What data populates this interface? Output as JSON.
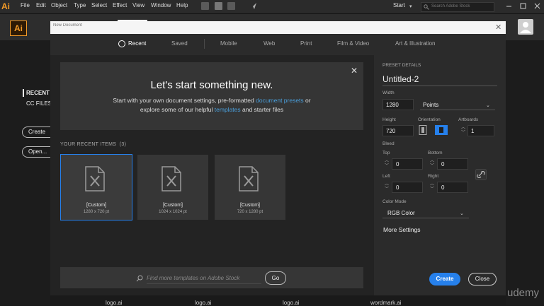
{
  "menubar": {
    "logo": "Ai",
    "items": [
      "File",
      "Edit",
      "Object",
      "Type",
      "Select",
      "Effect",
      "View",
      "Window",
      "Help"
    ],
    "workspace_label": "Start",
    "stock_search_placeholder": "Search Adobe Stock"
  },
  "app": {
    "logo": "Ai"
  },
  "document_name": {
    "placeholder": "New Document"
  },
  "tabs": [
    "Recent",
    "Saved",
    "Mobile",
    "Web",
    "Print",
    "Film & Video",
    "Art & Illustration"
  ],
  "hero": {
    "title": "Let's start something new.",
    "line1_pre": "Start with your own document settings, pre-formatted ",
    "line1_link": "document presets",
    "line1_post": " or",
    "line2_pre": "explore some of our helpful ",
    "line2_link": "templates",
    "line2_post": " and starter files"
  },
  "recent": {
    "title": "YOUR RECENT ITEMS",
    "count": "(3)",
    "items": [
      {
        "name": "[Custom]",
        "size": "1280 x 720 pt"
      },
      {
        "name": "[Custom]",
        "size": "1024 x 1024 pt"
      },
      {
        "name": "[Custom]",
        "size": "720 x 1280 pt"
      }
    ]
  },
  "search": {
    "placeholder": "Find more templates on Adobe Stock",
    "go_label": "Go"
  },
  "preset": {
    "header": "PRESET DETAILS",
    "name": "Untitled-2",
    "width_label": "Width",
    "width_value": "1280",
    "units": "Points",
    "height_label": "Height",
    "height_value": "720",
    "orientation_label": "Orientation",
    "artboards_label": "Artboards",
    "artboards_value": "1",
    "bleed_label": "Bleed",
    "top_label": "Top",
    "top_value": "0",
    "bottom_label": "Bottom",
    "bottom_value": "0",
    "left_label": "Left",
    "left_value": "0",
    "right_label": "Right",
    "right_value": "0",
    "color_mode_label": "Color Mode",
    "color_mode_value": "RGB Color",
    "more_settings": "More Settings"
  },
  "buttons": {
    "create": "Create",
    "close": "Close"
  },
  "start_screen": {
    "recent": "RECENT",
    "cc_files": "CC FILES",
    "create": "Create new...",
    "open": "Open..."
  },
  "bottom_files": [
    "logo.ai",
    "logo.ai",
    "logo.ai",
    "wordmark.ai"
  ],
  "watermark": "udemy",
  "colors": {
    "accent": "#2680eb",
    "brand": "#f29a28",
    "link": "#4a9eda"
  }
}
